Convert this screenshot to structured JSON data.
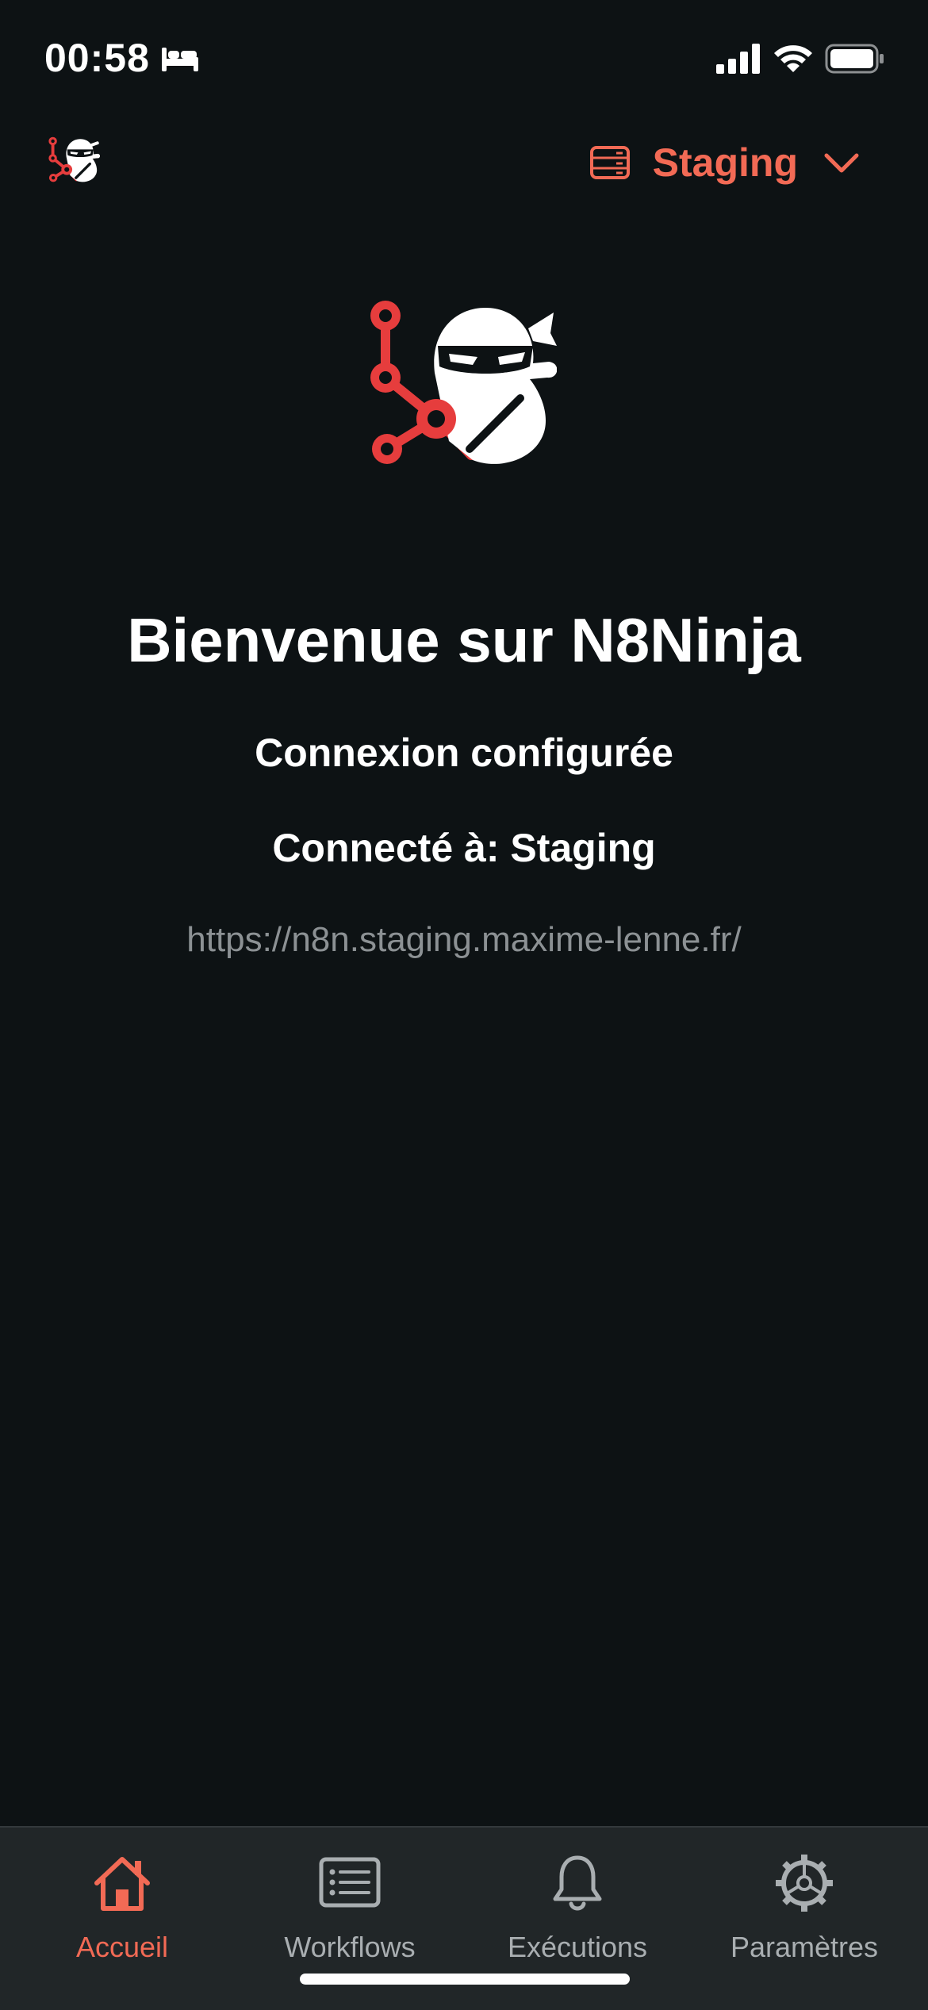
{
  "status_bar": {
    "time": "00:58",
    "icons": [
      "bed-icon",
      "cellular-signal-icon",
      "wifi-icon",
      "battery-icon"
    ]
  },
  "header": {
    "logo_icon": "ninja-logo-icon",
    "environment": {
      "label": "Staging",
      "icon": "server-icon",
      "chevron": "chevron-down-icon"
    }
  },
  "main": {
    "hero_icon": "ninja-logo-icon",
    "title": "Bienvenue sur N8Ninja",
    "connection_status": "Connexion configurée",
    "connected_to": "Connecté à: Staging",
    "server_url": "https://n8n.staging.maxime-lenne.fr/"
  },
  "tab_bar": {
    "items": [
      {
        "label": "Accueil",
        "icon": "home-icon",
        "active": true
      },
      {
        "label": "Workflows",
        "icon": "list-icon",
        "active": false
      },
      {
        "label": "Exécutions",
        "icon": "bell-icon",
        "active": false
      },
      {
        "label": "Paramètres",
        "icon": "gear-icon",
        "active": false
      }
    ]
  },
  "colors": {
    "background": "#0d1214",
    "accent": "#f26a55",
    "logo_red": "#e63d3d",
    "tab_bar_bg": "#212628",
    "muted_text": "#8c9194",
    "tab_inactive": "#a9aeb1"
  }
}
